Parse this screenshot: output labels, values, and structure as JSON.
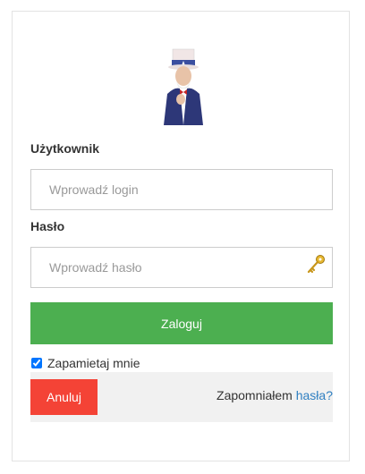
{
  "avatar": {
    "alt": "Uncle Sam"
  },
  "username": {
    "label": "Użytkownik",
    "placeholder": "Wprowadź login",
    "value": ""
  },
  "password": {
    "label": "Hasło",
    "placeholder": "Wprowadź hasło",
    "value": "",
    "icon": "key-icon"
  },
  "login_button": "Zaloguj",
  "remember": {
    "label": "Zapamietaj mnie",
    "checked": true
  },
  "cancel_button": "Anuluj",
  "forgot": {
    "text": "Zapomniałem",
    "link": "hasła?"
  },
  "colors": {
    "login": "#4caf50",
    "cancel": "#f44336",
    "link": "#2f7fc1",
    "footer_bg": "#f1f1f1"
  }
}
